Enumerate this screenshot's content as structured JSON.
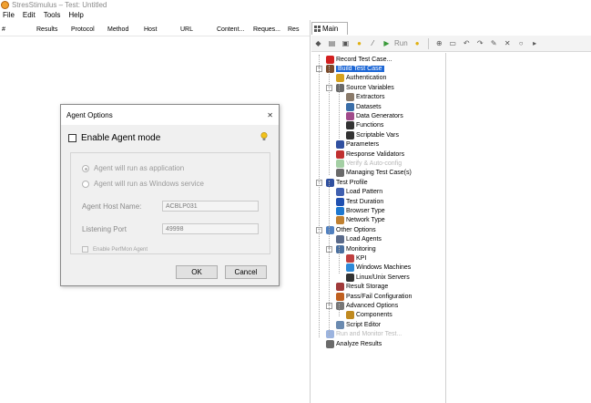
{
  "window": {
    "title": "StresStimulus – Test: Untitled"
  },
  "menu": [
    "File",
    "Edit",
    "Tools",
    "Help"
  ],
  "grid": {
    "columns": [
      "#",
      "Results",
      "Protocol",
      "Method",
      "Host",
      "URL",
      "Content...",
      "Reques...",
      "Res"
    ]
  },
  "dialog": {
    "title": "Agent Options",
    "enable_agent_mode": "Enable Agent mode",
    "run_as_application": "Agent will run as application",
    "run_as_service": "Agent will run as Windows service",
    "host_name_label": "Agent Host Name:",
    "host_name_value": "ACBLP031",
    "listening_port_label": "Listening Port",
    "listening_port_value": "49998",
    "enable_perfmon": "Enable PerfMon Agent",
    "ok": "OK",
    "cancel": "Cancel"
  },
  "panel": {
    "tab_label": "Main",
    "toolbar_run": "Run"
  },
  "tree": [
    {
      "label": "Record Test Case...",
      "icon": "record-icon",
      "color": "#d22020"
    },
    {
      "label": "Build Test Case",
      "icon": "build-icon",
      "color": "#7a4a2a",
      "selected": true
    },
    {
      "label": "Authentication",
      "icon": "key-icon",
      "color": "#d6a21e"
    },
    {
      "label": "Source Variables",
      "icon": "variables-icon",
      "color": "#6a6a6a"
    },
    {
      "label": "Extractors",
      "icon": "extractor-icon",
      "color": "#8a7a6a"
    },
    {
      "label": "Datasets",
      "icon": "dataset-icon",
      "color": "#3a6ea8"
    },
    {
      "label": "Data Generators",
      "icon": "generator-icon",
      "color": "#a04a8a"
    },
    {
      "label": "Functions",
      "icon": "function-icon",
      "color": "#333333"
    },
    {
      "label": "Scriptable Vars",
      "icon": "script-var-icon",
      "color": "#333333"
    },
    {
      "label": "Parameters",
      "icon": "parameters-icon",
      "color": "#3050a0"
    },
    {
      "label": "Response Validators",
      "icon": "validator-icon",
      "color": "#c03030"
    },
    {
      "label": "Verify & Auto-config",
      "icon": "verify-icon",
      "color": "#4aa04a",
      "disabled": true
    },
    {
      "label": "Managing Test Case(s)",
      "icon": "manage-icon",
      "color": "#6a6a6a"
    },
    {
      "label": "Test Profile",
      "icon": "profile-icon",
      "color": "#3050a0"
    },
    {
      "label": "Load Pattern",
      "icon": "load-pattern-icon",
      "color": "#4060b0"
    },
    {
      "label": "Test Duration",
      "icon": "clock-icon",
      "color": "#2050b0"
    },
    {
      "label": "Browser Type",
      "icon": "browser-icon",
      "color": "#1e78d0"
    },
    {
      "label": "Network Type",
      "icon": "network-icon",
      "color": "#c08030"
    },
    {
      "label": "Other Options",
      "icon": "options-icon",
      "color": "#5080c0"
    },
    {
      "label": "Load Agents",
      "icon": "agents-icon",
      "color": "#5a6a8a"
    },
    {
      "label": "Monitoring",
      "icon": "monitor-icon",
      "color": "#4a70a0"
    },
    {
      "label": "KPI",
      "icon": "kpi-icon",
      "color": "#c04040"
    },
    {
      "label": "Windows Machines",
      "icon": "windows-icon",
      "color": "#2e8ad8"
    },
    {
      "label": "Linux/Unix Servers",
      "icon": "linux-icon",
      "color": "#333333"
    },
    {
      "label": "Result Storage",
      "icon": "storage-icon",
      "color": "#a03a3a"
    },
    {
      "label": "Pass/Fail Configuration",
      "icon": "passfail-icon",
      "color": "#c06020"
    },
    {
      "label": "Advanced Options",
      "icon": "wrench-icon",
      "color": "#777777"
    },
    {
      "label": "Components",
      "icon": "components-icon",
      "color": "#c08a20"
    },
    {
      "label": "Script Editor",
      "icon": "script-editor-icon",
      "color": "#6a8ab0"
    },
    {
      "label": "Run and Monitor Test...",
      "icon": "run-monitor-icon",
      "color": "#3a6ac0",
      "disabled": true
    },
    {
      "label": "Analyze Results",
      "icon": "analyze-icon",
      "color": "#6a6a6a"
    }
  ]
}
